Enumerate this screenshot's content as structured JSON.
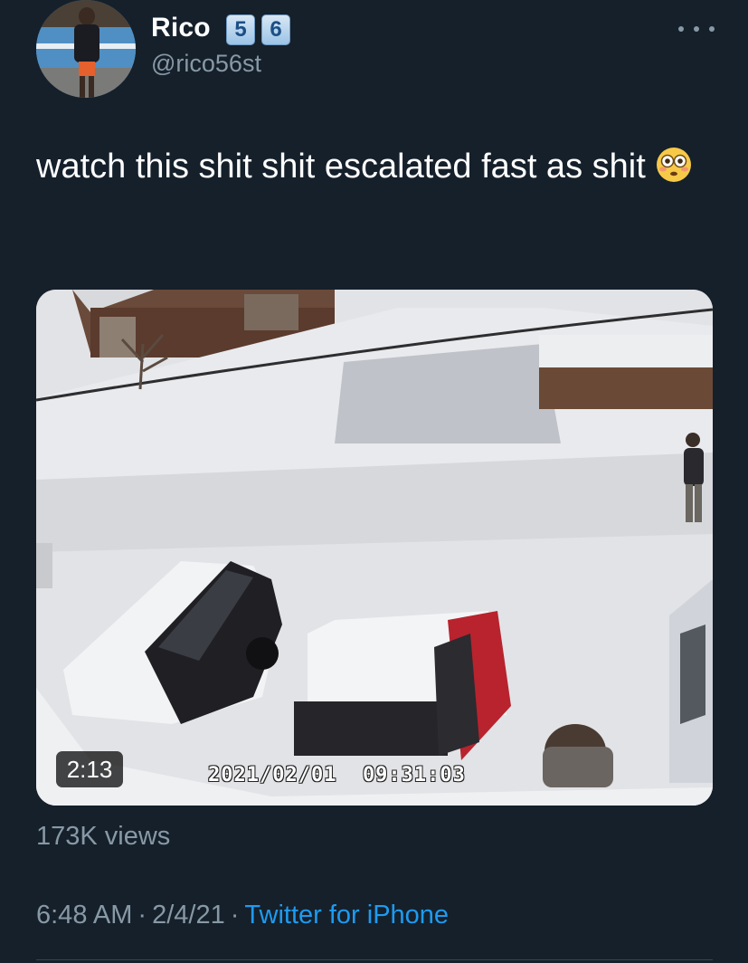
{
  "tweet": {
    "author": {
      "display_name": "Rico",
      "badges": [
        "5",
        "6"
      ],
      "handle": "@rico56st"
    },
    "text": "watch this shit shit escalated fast as shit",
    "emoji": "flushed-face",
    "media": {
      "duration": "2:13",
      "camera_timestamp": "2021/02/01  09:31:03"
    },
    "views": "173K views",
    "time": "6:48 AM",
    "date": "2/4/21",
    "separator": "·",
    "source": "Twitter for iPhone"
  },
  "colors": {
    "background": "#15202b",
    "secondary_text": "#8899a6",
    "link": "#1d9bf0"
  },
  "icons": [
    "more-options-icon",
    "flushed-face-emoji",
    "avatar"
  ]
}
